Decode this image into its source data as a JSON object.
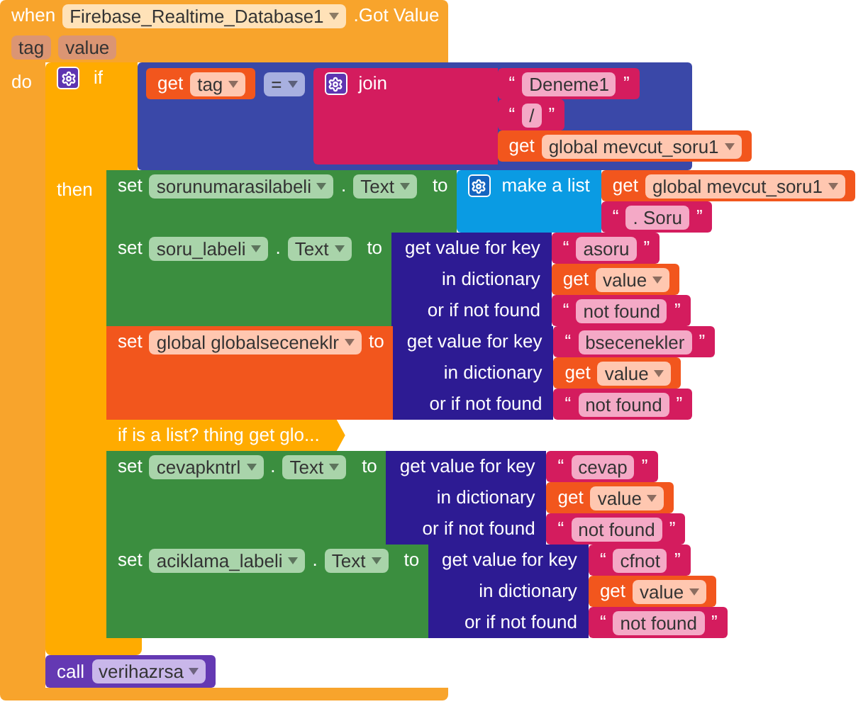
{
  "event": {
    "keyword": "when",
    "component": "Firebase_Realtime_Database1",
    "event_name": ".Got Value",
    "params": [
      "tag",
      "value"
    ],
    "do_label": "do"
  },
  "if_block": {
    "keyword": "if",
    "then_label": "then",
    "condition": {
      "kind": "compare",
      "operator": "=",
      "left": {
        "kind": "get",
        "keyword": "get",
        "variable": "tag"
      },
      "right": {
        "kind": "join",
        "keyword": "join",
        "items": [
          {
            "kind": "text",
            "open": "“",
            "value": "Deneme1",
            "close": "”"
          },
          {
            "kind": "text",
            "open": "“",
            "value": "/",
            "close": "”"
          },
          {
            "kind": "get",
            "keyword": "get",
            "variable": "global mevcut_soru1"
          }
        ]
      }
    },
    "statements": [
      {
        "kind": "set_property",
        "keyword": "set",
        "component": "sorunumarasilabeli",
        "dot": ".",
        "property": "Text",
        "to": "to",
        "value": {
          "kind": "make_list",
          "keyword": "make a list",
          "items": [
            {
              "kind": "get",
              "keyword": "get",
              "variable": "global mevcut_soru1"
            },
            {
              "kind": "text",
              "open": "“",
              "value": ". Soru",
              "close": "”"
            }
          ]
        }
      },
      {
        "kind": "set_property",
        "keyword": "set",
        "component": "soru_labeli",
        "dot": ".",
        "property": "Text",
        "to": "to",
        "value": {
          "kind": "dict_lookup",
          "labels": [
            "get value for key",
            "in dictionary",
            "or if not found"
          ],
          "args": [
            {
              "kind": "text",
              "open": "“",
              "value": "asoru",
              "close": "”"
            },
            {
              "kind": "get",
              "keyword": "get",
              "variable": "value"
            },
            {
              "kind": "text",
              "open": "“",
              "value": "not found",
              "close": "”"
            }
          ]
        }
      },
      {
        "kind": "set_global",
        "keyword": "set",
        "variable": "global globalseceneklr",
        "to": "to",
        "value": {
          "kind": "dict_lookup",
          "labels": [
            "get value for key",
            "in dictionary",
            "or if not found"
          ],
          "args": [
            {
              "kind": "text",
              "open": "“",
              "value": "bsecenekler",
              "close": "”"
            },
            {
              "kind": "get",
              "keyword": "get",
              "variable": "value"
            },
            {
              "kind": "text",
              "open": "“",
              "value": "not found",
              "close": "”"
            }
          ]
        }
      },
      {
        "kind": "collapsed",
        "label": "if is a list? thing get glo..."
      },
      {
        "kind": "set_property",
        "keyword": "set",
        "component": "cevapkntrl",
        "dot": ".",
        "property": "Text",
        "to": "to",
        "value": {
          "kind": "dict_lookup",
          "labels": [
            "get value for key",
            "in dictionary",
            "or if not found"
          ],
          "args": [
            {
              "kind": "text",
              "open": "“",
              "value": "cevap",
              "close": "”"
            },
            {
              "kind": "get",
              "keyword": "get",
              "variable": "value"
            },
            {
              "kind": "text",
              "open": "“",
              "value": "not found",
              "close": "”"
            }
          ]
        }
      },
      {
        "kind": "set_property",
        "keyword": "set",
        "component": "aciklama_labeli",
        "dot": ".",
        "property": "Text",
        "to": "to",
        "value": {
          "kind": "dict_lookup",
          "labels": [
            "get value for key",
            "in dictionary",
            "or if not found"
          ],
          "args": [
            {
              "kind": "text",
              "open": "“",
              "value": "cfnot",
              "close": "”"
            },
            {
              "kind": "get",
              "keyword": "get",
              "variable": "value"
            },
            {
              "kind": "text",
              "open": "“",
              "value": "not found",
              "close": "”"
            }
          ]
        }
      }
    ]
  },
  "after": [
    {
      "kind": "call",
      "keyword": "call",
      "procedure": "verihazrsa"
    }
  ]
}
